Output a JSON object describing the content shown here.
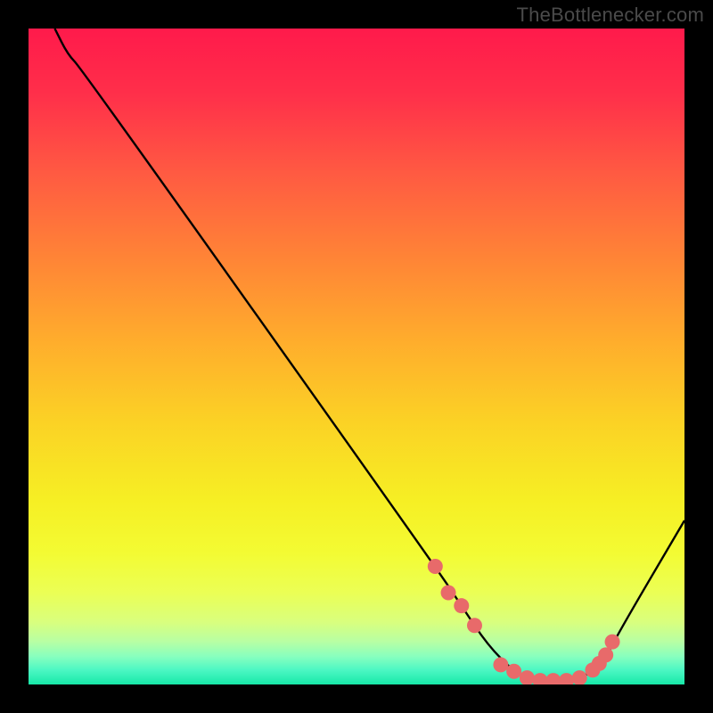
{
  "attribution": "TheBottlenecker.com",
  "colors": {
    "frame": "#000000",
    "curve": "#000000",
    "point_fill": "#e86a6a",
    "gradient_stops": [
      {
        "offset": 0.0,
        "color": "#ff1a4b"
      },
      {
        "offset": 0.1,
        "color": "#ff2f4a"
      },
      {
        "offset": 0.22,
        "color": "#ff5a42"
      },
      {
        "offset": 0.35,
        "color": "#ff8436"
      },
      {
        "offset": 0.48,
        "color": "#ffae2c"
      },
      {
        "offset": 0.6,
        "color": "#fbd225"
      },
      {
        "offset": 0.72,
        "color": "#f6ef24"
      },
      {
        "offset": 0.8,
        "color": "#f3fb33"
      },
      {
        "offset": 0.86,
        "color": "#ebff55"
      },
      {
        "offset": 0.905,
        "color": "#d9ff7e"
      },
      {
        "offset": 0.935,
        "color": "#b7ffa4"
      },
      {
        "offset": 0.958,
        "color": "#86ffbf"
      },
      {
        "offset": 0.978,
        "color": "#4cf7c3"
      },
      {
        "offset": 1.0,
        "color": "#17e8a8"
      }
    ]
  },
  "chart_data": {
    "type": "line",
    "title": "",
    "xlabel": "",
    "ylabel": "",
    "xlim": [
      0,
      100
    ],
    "ylim": [
      0,
      100
    ],
    "grid": false,
    "legend": false,
    "series": [
      {
        "name": "bottleneck-curve",
        "x": [
          4,
          6,
          8,
          62,
          66,
          70,
          74,
          76,
          78,
          80,
          82,
          84,
          86,
          88,
          90,
          100
        ],
        "y": [
          100,
          96,
          94,
          18,
          12,
          6,
          2,
          1,
          0.5,
          0.5,
          0.5,
          1,
          2,
          4,
          8,
          25
        ]
      }
    ],
    "points": {
      "name": "highlighted-points",
      "x": [
        62,
        64,
        66,
        68,
        72,
        74,
        76,
        78,
        80,
        82,
        84,
        86,
        87,
        88,
        89
      ],
      "y": [
        18,
        14,
        12,
        9,
        3,
        2,
        1,
        0.6,
        0.6,
        0.6,
        1,
        2.2,
        3.2,
        4.5,
        6.5
      ]
    }
  }
}
